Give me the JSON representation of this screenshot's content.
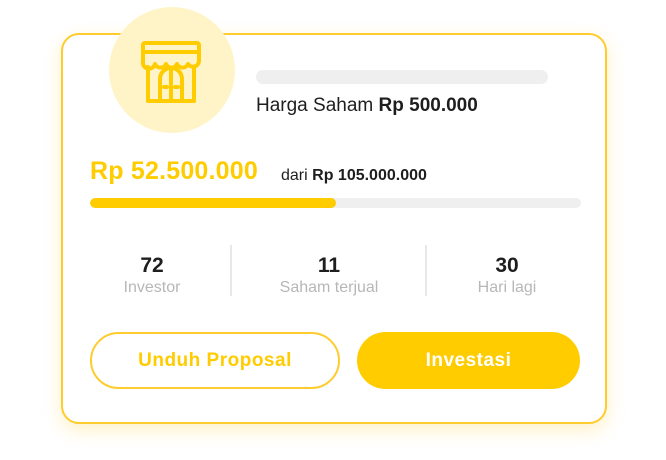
{
  "project": {
    "icon": "storefront-icon",
    "share_price_label": "Harga Saham",
    "share_price_value": "Rp 500.000"
  },
  "funding": {
    "raised": "Rp 52.500.000",
    "target_prefix": "dari",
    "target": "Rp 105.000.000",
    "progress_fraction": 0.5
  },
  "stats": [
    {
      "value": "72",
      "label": "Investor"
    },
    {
      "value": "11",
      "label": "Saham terjual"
    },
    {
      "value": "30",
      "label": "Hari lagi"
    }
  ],
  "actions": {
    "download_label": "Unduh Proposal",
    "invest_label": "Investasi"
  },
  "colors": {
    "accent": "#ffcc00",
    "accent_light": "#fff4c8",
    "track": "#efefef",
    "muted_text": "#b7b7b7"
  }
}
